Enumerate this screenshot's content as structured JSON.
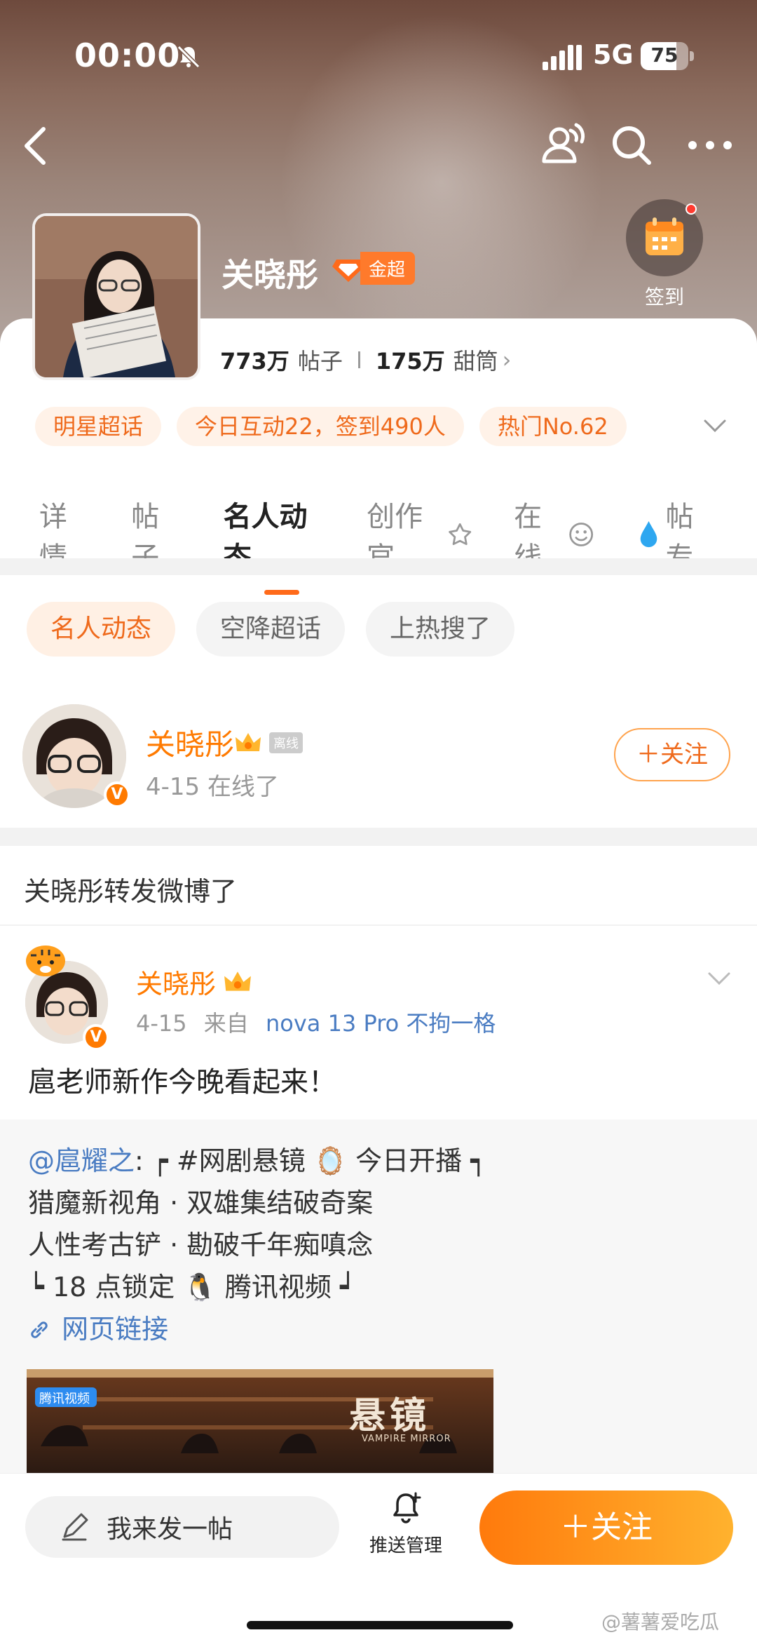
{
  "status_bar": {
    "time": "00:00",
    "network": "5G",
    "battery": "75",
    "battery_level": 0.75
  },
  "profile": {
    "name": "关晓彤",
    "badge_label": "金超",
    "signin_label": "签到",
    "posts_count": "773万",
    "posts_unit": "帖子",
    "fans_count": "175万",
    "fans_unit": "甜筒"
  },
  "tags": [
    "明星超话",
    "今日互动22，签到490人",
    "热门No.62"
  ],
  "tabs": [
    {
      "label": "详情",
      "icon": ""
    },
    {
      "label": "帖子",
      "icon": ""
    },
    {
      "label": "名人动态",
      "icon": ""
    },
    {
      "label": "创作官",
      "icon": "star-badge-icon"
    },
    {
      "label": "在线",
      "icon": "smiley-icon"
    },
    {
      "label": "帖专",
      "icon": "water-drop-icon"
    }
  ],
  "chips": [
    "名人动态",
    "空降超话",
    "上热搜了"
  ],
  "user_row": {
    "name": "关晓彤",
    "status_tag": "离线",
    "subtitle": "4-15 在线了",
    "follow_label": "＋关注"
  },
  "repost_note": "关晓彤转发微博了",
  "post": {
    "author": "关晓彤",
    "date": "4-15",
    "from_prefix": "来自",
    "device": "nova 13 Pro 不拘一格",
    "text": "扈老师新作今晚看起来！"
  },
  "quote": {
    "mention": "@扈耀之",
    "line1_rest": ": ┍ #网剧悬镜 🪞 今日开播 ┑",
    "line2": "猎魔新视角 · 双雄集结破奇案",
    "line3": "人性考古铲 · 勘破千年痴嗔念",
    "line4": "┕ 18 点锁定 🐧 腾讯视频 ┙",
    "link": "网页链接",
    "image_title": "悬镜",
    "image_subtitle": "VAMPIRE MIRROR",
    "image_logo": "腾讯视频"
  },
  "bottom_bar": {
    "compose_label": "我来发一帖",
    "push_label": "推送管理",
    "follow_label": "＋关注"
  },
  "watermark": "@薯薯爱吃瓜",
  "colors": {
    "accent": "#ff7a00",
    "tag_bg": "#fff2e8",
    "link": "#4a7cc2"
  }
}
